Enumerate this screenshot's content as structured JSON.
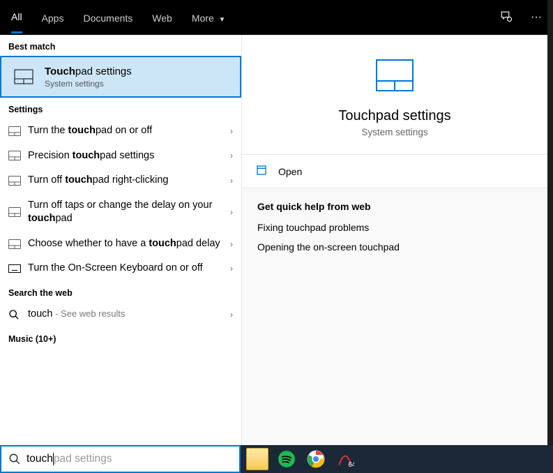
{
  "header": {
    "tabs": [
      "All",
      "Apps",
      "Documents",
      "Web",
      "More"
    ],
    "active_index": 0
  },
  "left": {
    "best_match_label": "Best match",
    "best_match": {
      "title_bold": "Touch",
      "title_rest": "pad settings",
      "subtitle": "System settings"
    },
    "settings_label": "Settings",
    "settings": [
      {
        "pre": "Turn the ",
        "bold": "touch",
        "post": "pad on or off",
        "icon": "touchpad"
      },
      {
        "pre": "Precision ",
        "bold": "touch",
        "post": "pad settings",
        "icon": "touchpad"
      },
      {
        "pre": "Turn off ",
        "bold": "touch",
        "post": "pad right-clicking",
        "icon": "touchpad"
      },
      {
        "pre": "Turn off taps or change the delay on your ",
        "bold": "touch",
        "post": "pad",
        "icon": "touchpad"
      },
      {
        "pre": "Choose whether to have a ",
        "bold": "touch",
        "post": "pad delay",
        "icon": "touchpad"
      },
      {
        "pre": "Turn the On-Screen Keyboard on or off",
        "bold": "",
        "post": "",
        "icon": "keyboard"
      }
    ],
    "web_label": "Search the web",
    "web": {
      "query": "touch",
      "suffix": " - See web results"
    },
    "music_label": "Music (10+)"
  },
  "right": {
    "title": "Touchpad settings",
    "subtitle": "System settings",
    "open_label": "Open",
    "help_label": "Get quick help from web",
    "help_links": [
      "Fixing touchpad problems",
      "Opening the on-screen touchpad"
    ]
  },
  "search": {
    "value": "touch",
    "placeholder": "pad settings"
  },
  "taskbar": [
    "file-explorer",
    "spotify",
    "chrome",
    "app-x"
  ]
}
